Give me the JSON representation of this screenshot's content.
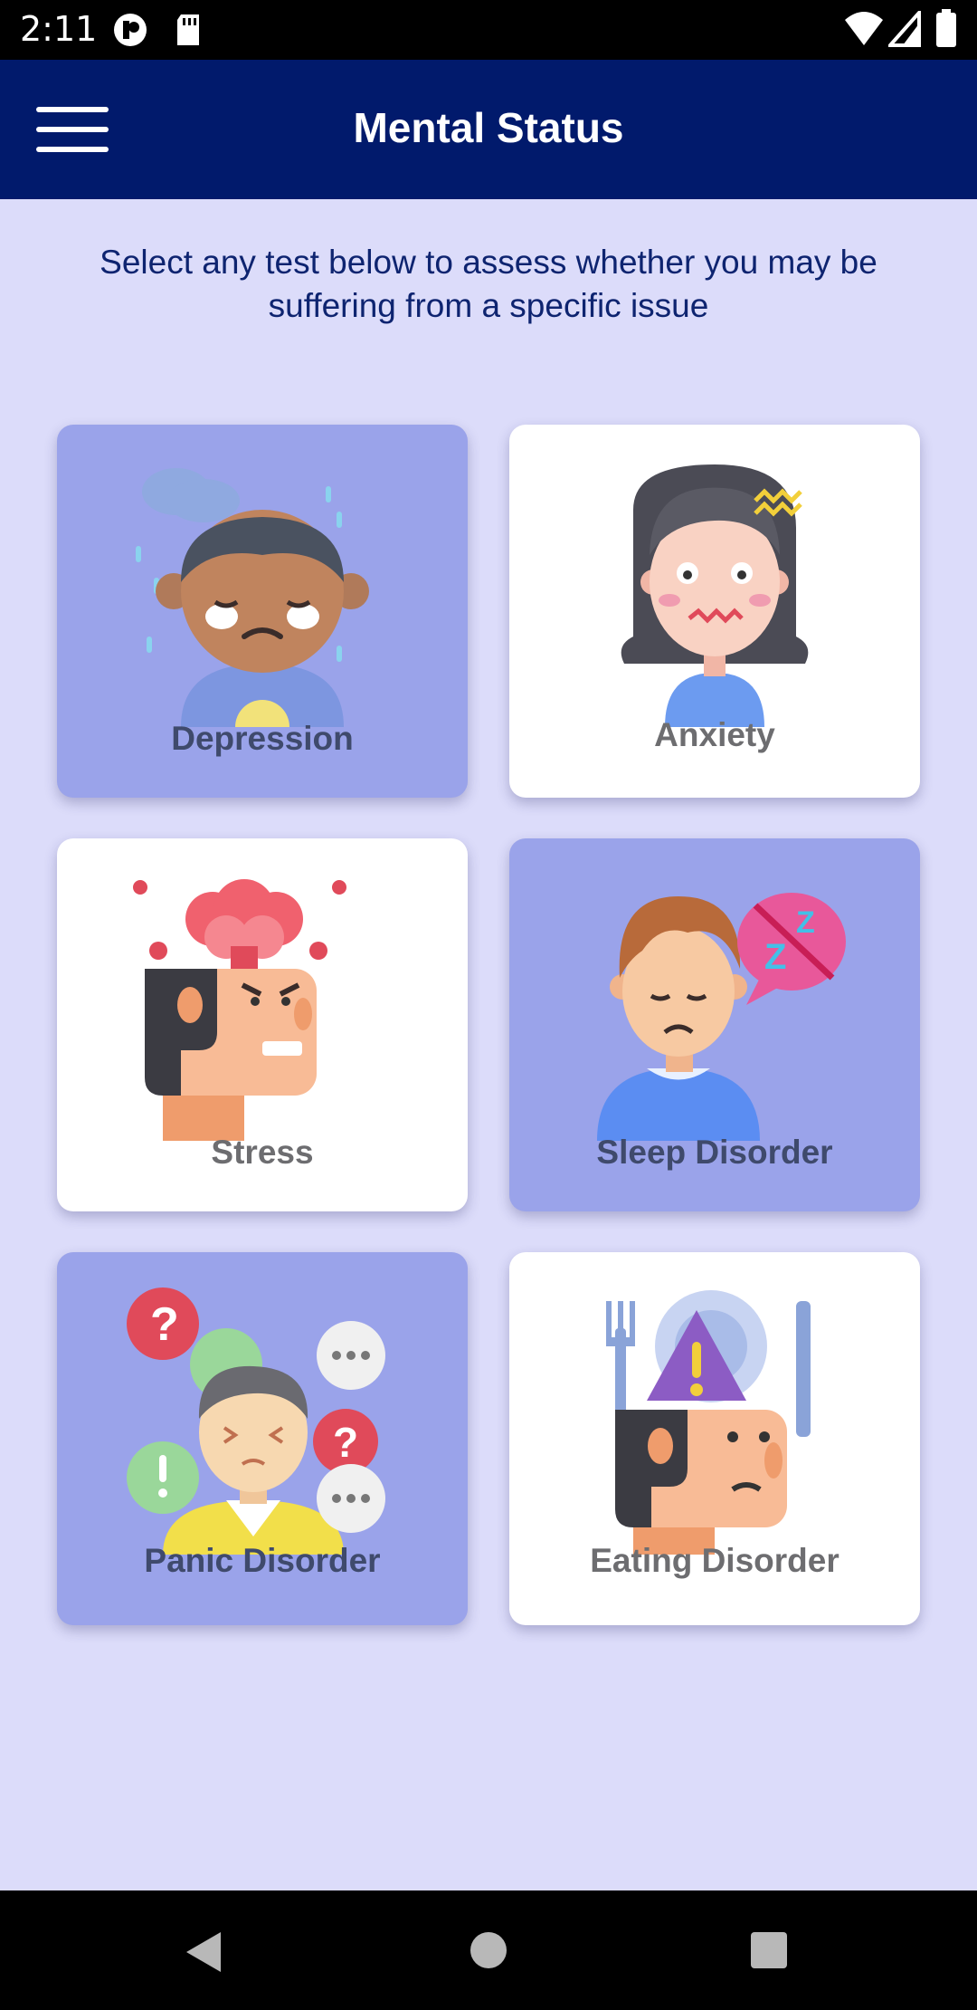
{
  "status_bar": {
    "time": "2:11"
  },
  "app_bar": {
    "title": "Mental Status"
  },
  "intro_text": "Select any test below to assess whether you may be suffering from a specific issue",
  "tests": [
    {
      "label": "Depression",
      "icon": "depression-illustration",
      "style": "purple"
    },
    {
      "label": "Anxiety",
      "icon": "anxiety-illustration",
      "style": "white"
    },
    {
      "label": "Stress",
      "icon": "stress-illustration",
      "style": "white"
    },
    {
      "label": "Sleep Disorder",
      "icon": "sleep-disorder-illustration",
      "style": "purple"
    },
    {
      "label": "Panic Disorder",
      "icon": "panic-disorder-illustration",
      "style": "purple"
    },
    {
      "label": "Eating Disorder",
      "icon": "eating-disorder-illustration",
      "style": "white"
    }
  ],
  "colors": {
    "app_bar": "#011a6c",
    "background": "#dcdcfa",
    "card_purple": "#9aa3ea",
    "card_white": "#ffffff"
  }
}
